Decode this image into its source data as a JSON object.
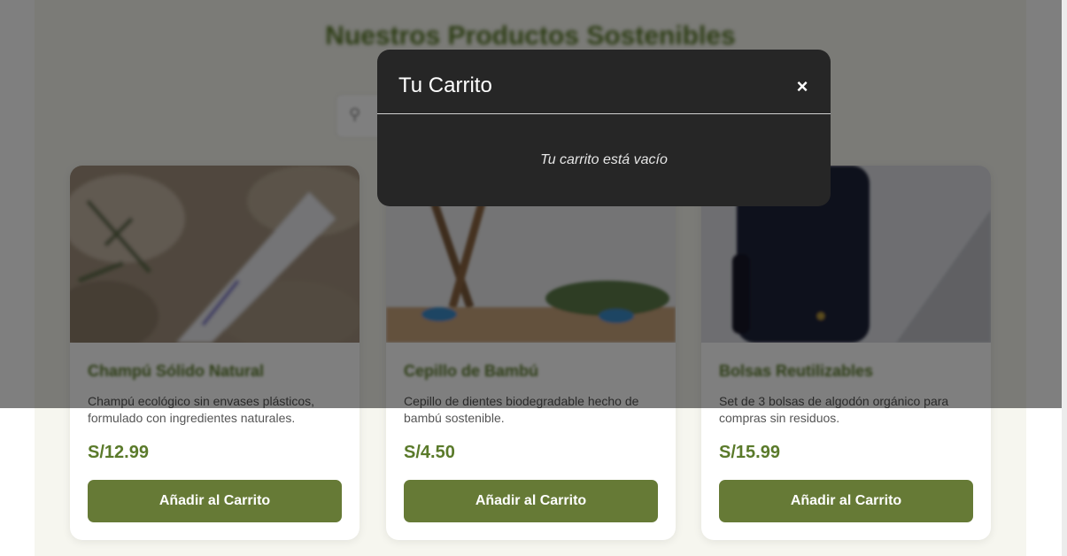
{
  "page": {
    "title": "Nuestros Productos Sostenibles",
    "search_icon": "search-icon"
  },
  "products": [
    {
      "name": "Champú Sólido Natural",
      "description": "Champú ecológico sin envases plásticos, formulado con ingredientes naturales.",
      "price": "S/12.99",
      "button_label": "Añadir al Carrito"
    },
    {
      "name": "Cepillo de Bambú",
      "description": "Cepillo de dientes biodegradable hecho de bambú sostenible.",
      "price": "S/4.50",
      "button_label": "Añadir al Carrito"
    },
    {
      "name": "Bolsas Reutilizables",
      "description": "Set de 3 bolsas de algodón orgánico para compras sin residuos.",
      "price": "S/15.99",
      "button_label": "Añadir al Carrito"
    }
  ],
  "cart_modal": {
    "title": "Tu Carrito",
    "close_label": "×",
    "empty_message": "Tu carrito está vacío"
  },
  "colors": {
    "brand_green": "#5a7a2a",
    "button_green": "#667a36",
    "modal_bg": "#262626"
  }
}
